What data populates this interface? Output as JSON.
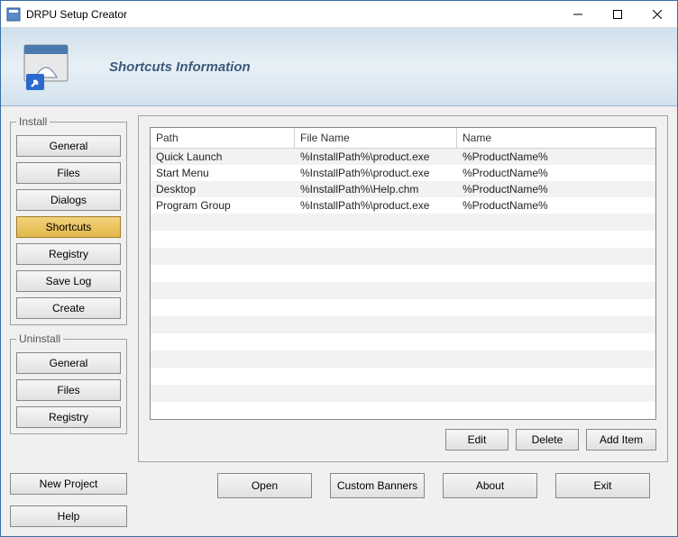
{
  "window": {
    "title": "DRPU Setup Creator"
  },
  "header": {
    "title": "Shortcuts Information"
  },
  "sidebar": {
    "install": {
      "legend": "Install",
      "items": [
        "General",
        "Files",
        "Dialogs",
        "Shortcuts",
        "Registry",
        "Save Log",
        "Create"
      ],
      "active_index": 3
    },
    "uninstall": {
      "legend": "Uninstall",
      "items": [
        "General",
        "Files",
        "Registry"
      ]
    }
  },
  "table": {
    "columns": [
      "Path",
      "File Name",
      "Name"
    ],
    "rows": [
      {
        "path": "Quick Launch",
        "file": "%InstallPath%\\product.exe",
        "name": "%ProductName%"
      },
      {
        "path": "Start Menu",
        "file": "%InstallPath%\\product.exe",
        "name": "%ProductName%"
      },
      {
        "path": "Desktop",
        "file": "%InstallPath%\\Help.chm",
        "name": "%ProductName%"
      },
      {
        "path": "Program Group",
        "file": "%InstallPath%\\product.exe",
        "name": "%ProductName%"
      }
    ]
  },
  "main_buttons": {
    "edit": "Edit",
    "delete": "Delete",
    "add": "Add Item"
  },
  "footer_left": {
    "new_project": "New Project",
    "help": "Help"
  },
  "footer_right": {
    "open": "Open",
    "banners": "Custom Banners",
    "about": "About",
    "exit": "Exit"
  }
}
